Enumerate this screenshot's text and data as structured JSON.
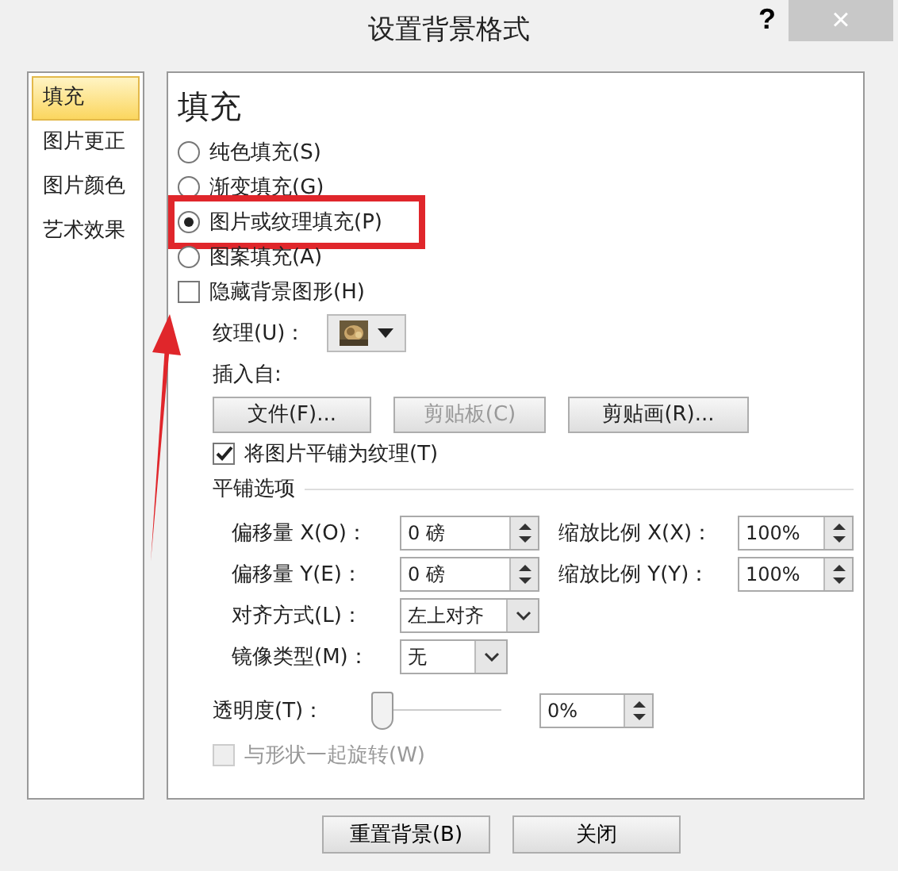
{
  "window": {
    "title": "设置背景格式",
    "help": "?",
    "close": "×"
  },
  "sidebar": {
    "items": [
      {
        "label": "填充",
        "selected": true
      },
      {
        "label": "图片更正",
        "selected": false
      },
      {
        "label": "图片颜色",
        "selected": false
      },
      {
        "label": "艺术效果",
        "selected": false
      }
    ]
  },
  "panel": {
    "heading": "填充",
    "fill_options": [
      {
        "label": "纯色填充(S)",
        "selected": false,
        "highlighted": false
      },
      {
        "label": "渐变填充(G)",
        "selected": false,
        "highlighted": false
      },
      {
        "label": "图片或纹理填充(P)",
        "selected": true,
        "highlighted": true
      },
      {
        "label": "图案填充(A)",
        "selected": false,
        "highlighted": false
      }
    ],
    "hide_background": {
      "label": "隐藏背景图形(H)",
      "checked": false
    },
    "texture": {
      "label": "纹理(U)："
    },
    "insert_from": {
      "label": "插入自:",
      "buttons": [
        {
          "label": "文件(F)...",
          "disabled": false
        },
        {
          "label": "剪贴板(C)",
          "disabled": true
        },
        {
          "label": "剪贴画(R)...",
          "disabled": false
        }
      ]
    },
    "tile_as_texture": {
      "label": "将图片平铺为纹理(T)",
      "checked": true
    },
    "tiling": {
      "title": "平铺选项",
      "fields": [
        {
          "label": "偏移量 X(O)：",
          "value": "0 磅"
        },
        {
          "label": "缩放比例 X(X)：",
          "value": "100%"
        },
        {
          "label": "偏移量 Y(E)：",
          "value": "0 磅"
        },
        {
          "label": "缩放比例 Y(Y)：",
          "value": "100%"
        }
      ],
      "alignment": {
        "label": "对齐方式(L)：",
        "value": "左上对齐"
      },
      "mirror": {
        "label": "镜像类型(M)：",
        "value": "无"
      }
    },
    "transparency": {
      "label": "透明度(T)：",
      "level": 0,
      "value": "0%"
    },
    "rotate_with_shape": {
      "label": "与形状一起旋转(W)",
      "checked": false,
      "disabled": true
    }
  },
  "buttons": [
    {
      "label": "重置背景(B)"
    },
    {
      "label": "关闭"
    }
  ]
}
